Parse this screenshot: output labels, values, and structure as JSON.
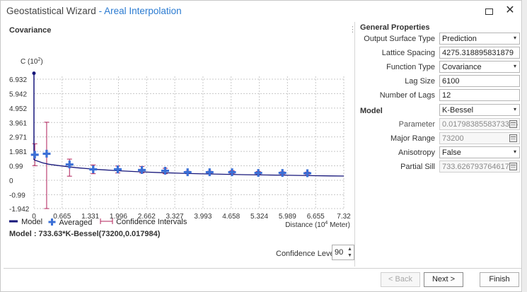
{
  "window": {
    "title": "Geostatistical Wizard",
    "subtitle": "- Areal Interpolation",
    "maximize_icon": "maximize-icon",
    "close_icon": "close-icon",
    "close_glyph": "✕"
  },
  "left_panel": {
    "title": "Covariance",
    "menu_glyph": "⋮",
    "legend": {
      "model": "Model",
      "averaged": "Averaged",
      "ci": "Confidence Intervals"
    },
    "model_text": "Model : 733.63*K-Bessel(73200,0.017984)",
    "confidence_label": "Confidence Level",
    "confidence_value": "90"
  },
  "chart_data": {
    "type": "scatter",
    "ylabel_base": "C (10",
    "ylabel_exp": "2",
    "ylabel_tail": ")",
    "xlabel_base": "Distance (10",
    "xlabel_exp": "4",
    "xlabel_tail": " Meter)",
    "x_ticks": [
      "0",
      "0.665",
      "1.331",
      "1.996",
      "2.662",
      "3.327",
      "3.993",
      "4.658",
      "5.324",
      "5.989",
      "6.655",
      "7.32"
    ],
    "y_ticks": [
      "6.932",
      "5.942",
      "4.952",
      "3.961",
      "2.971",
      "1.981",
      "0.99",
      "0",
      "-0.99",
      "-1.942"
    ],
    "xlim": [
      0,
      7.32
    ],
    "ylim": [
      -1.942,
      7.4
    ],
    "grid": true,
    "model_curve": {
      "nugget_top": 7.34,
      "points": [
        [
          0,
          1.4
        ],
        [
          0.1,
          1.3
        ],
        [
          0.2,
          1.2
        ],
        [
          0.35,
          1.1
        ],
        [
          0.6,
          1.0
        ],
        [
          1.0,
          0.86
        ],
        [
          1.5,
          0.74
        ],
        [
          2.0,
          0.65
        ],
        [
          2.5,
          0.58
        ],
        [
          3.0,
          0.52
        ],
        [
          3.5,
          0.48
        ],
        [
          4.0,
          0.44
        ],
        [
          4.5,
          0.41
        ],
        [
          5.0,
          0.38
        ],
        [
          5.5,
          0.36
        ],
        [
          6.0,
          0.34
        ],
        [
          6.5,
          0.32
        ],
        [
          7.0,
          0.3
        ],
        [
          7.32,
          0.29
        ]
      ]
    },
    "averaged": [
      {
        "x": 0.02,
        "y": 1.75,
        "ci": [
          1.0,
          2.5
        ]
      },
      {
        "x": 0.3,
        "y": 1.82,
        "ci": [
          -1.942,
          3.98
        ]
      },
      {
        "x": 0.84,
        "y": 1.08,
        "ci": [
          0.28,
          1.45
        ]
      },
      {
        "x": 1.4,
        "y": 0.75,
        "ci": [
          0.45,
          1.05
        ]
      },
      {
        "x": 1.98,
        "y": 0.75,
        "ci": [
          0.5,
          0.98
        ]
      },
      {
        "x": 2.55,
        "y": 0.7,
        "ci": [
          0.5,
          0.95
        ]
      },
      {
        "x": 3.1,
        "y": 0.65,
        "ci": [
          0.45,
          0.82
        ]
      },
      {
        "x": 3.63,
        "y": 0.55,
        "ci": [
          0.45,
          0.62
        ]
      },
      {
        "x": 4.15,
        "y": 0.55,
        "ci": [
          0.45,
          0.62
        ]
      },
      {
        "x": 4.68,
        "y": 0.55,
        "ci": [
          0.45,
          0.65
        ]
      },
      {
        "x": 5.3,
        "y": 0.5,
        "ci": [
          0.42,
          0.6
        ]
      },
      {
        "x": 5.87,
        "y": 0.5,
        "ci": [
          0.42,
          0.58
        ]
      },
      {
        "x": 6.46,
        "y": 0.48,
        "ci": [
          0.4,
          0.56
        ]
      }
    ],
    "colors": {
      "model": "#16167a",
      "averaged": "#3a6fd6",
      "ci": "#b0205a"
    }
  },
  "properties": {
    "general_title": "General Properties",
    "output_surface_type": {
      "label": "Output Surface Type",
      "value": "Prediction"
    },
    "lattice_spacing": {
      "label": "Lattice Spacing",
      "value": "4275.318895831879"
    },
    "function_type": {
      "label": "Function Type",
      "value": "Covariance"
    },
    "lag_size": {
      "label": "Lag Size",
      "value": "6100"
    },
    "number_of_lags": {
      "label": "Number of Lags",
      "value": "12"
    },
    "model_title": "Model",
    "model": {
      "value": "K-Bessel"
    },
    "parameter": {
      "label": "Parameter",
      "value": "0.0179838558373386"
    },
    "major_range": {
      "label": "Major Range",
      "value": "73200"
    },
    "anisotropy": {
      "label": "Anisotropy",
      "value": "False"
    },
    "partial_sill": {
      "label": "Partial Sill",
      "value": "733.6267937646178"
    },
    "dropdown_icon": "chevron-down-icon",
    "dropdown_glyph": "▾",
    "calendar_icon": "calendar-icon"
  },
  "footer": {
    "back": "< Back",
    "next": "Next >",
    "finish": "Finish"
  }
}
